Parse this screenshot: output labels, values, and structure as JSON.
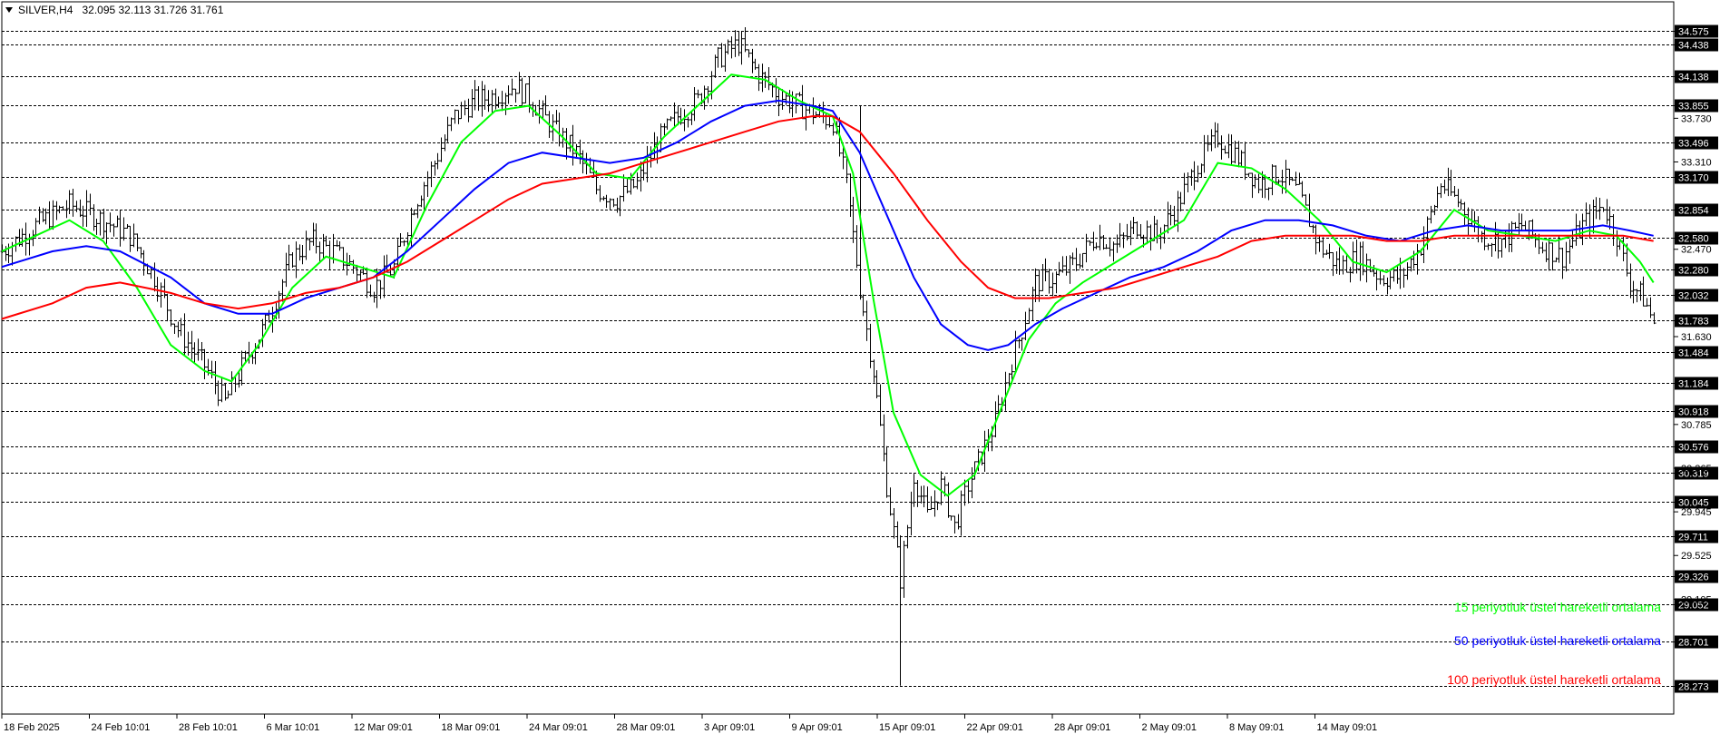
{
  "header": {
    "symbol_tf": "SILVER,H4",
    "ohlc": "32.095 32.113 31.726 31.761"
  },
  "legend": [
    {
      "label": "15 periyotluk üstel hareketli ortalama",
      "color": "#00ff00"
    },
    {
      "label": "50 periyotluk üstel hareketli ortalama",
      "color": "#0000ff"
    },
    {
      "label": "100 periyotluk üstel hareketli ortalama",
      "color": "#ff0000"
    }
  ],
  "chart_data": {
    "type": "line",
    "title": "SILVER,H4",
    "ylim": [
      28.0,
      34.85
    ],
    "grid": false,
    "legend_position": "bottom-right",
    "x_tick_labels": [
      "18 Feb 2025",
      "24 Feb 10:01",
      "28 Feb 10:01",
      "6 Mar 10:01",
      "12 Mar 09:01",
      "18 Mar 09:01",
      "24 Mar 09:01",
      "28 Mar 09:01",
      "3 Apr 09:01",
      "9 Apr 09:01",
      "15 Apr 09:01",
      "22 Apr 09:01",
      "28 Apr 09:01",
      "2 May 09:01",
      "8 May 09:01",
      "14 May 09:01"
    ],
    "y_tick_labels": [
      "33.730",
      "33.310",
      "32.470",
      "31.630",
      "30.785",
      "30.365",
      "29.945",
      "29.525",
      "29.105"
    ],
    "price_levels": [
      "34.575",
      "34.438",
      "34.138",
      "33.855",
      "33.496",
      "33.170",
      "32.854",
      "32.580",
      "32.280",
      "32.032",
      "31.783",
      "31.484",
      "31.184",
      "30.918",
      "30.576",
      "30.319",
      "30.045",
      "29.711",
      "29.326",
      "29.052",
      "28.701",
      "28.273"
    ],
    "close_series": {
      "name": "SILVER close",
      "points": [
        [
          0,
          32.45
        ],
        [
          10,
          32.7
        ],
        [
          20,
          32.9
        ],
        [
          30,
          32.75
        ],
        [
          38,
          32.6
        ],
        [
          45,
          32.2
        ],
        [
          52,
          31.7
        ],
        [
          60,
          31.35
        ],
        [
          66,
          31.0
        ],
        [
          72,
          31.4
        ],
        [
          78,
          31.75
        ],
        [
          86,
          32.4
        ],
        [
          92,
          32.55
        ],
        [
          98,
          32.45
        ],
        [
          104,
          32.3
        ],
        [
          110,
          32.1
        ],
        [
          116,
          32.3
        ],
        [
          122,
          32.9
        ],
        [
          128,
          33.3
        ],
        [
          134,
          33.75
        ],
        [
          140,
          33.9
        ],
        [
          146,
          33.95
        ],
        [
          152,
          34.05
        ],
        [
          158,
          33.85
        ],
        [
          164,
          33.6
        ],
        [
          170,
          33.4
        ],
        [
          176,
          33.05
        ],
        [
          182,
          32.95
        ],
        [
          188,
          33.1
        ],
        [
          194,
          33.5
        ],
        [
          200,
          33.75
        ],
        [
          206,
          33.9
        ],
        [
          212,
          34.3
        ],
        [
          218,
          34.45
        ],
        [
          224,
          34.15
        ],
        [
          230,
          33.95
        ],
        [
          236,
          33.85
        ],
        [
          242,
          33.75
        ],
        [
          246,
          33.7
        ],
        [
          250,
          33.1
        ],
        [
          254,
          32.1
        ],
        [
          258,
          31.3
        ],
        [
          262,
          30.2
        ],
        [
          266,
          29.3
        ],
        [
          270,
          30.3
        ],
        [
          274,
          29.9
        ],
        [
          278,
          30.2
        ],
        [
          282,
          29.8
        ],
        [
          286,
          30.2
        ],
        [
          290,
          30.5
        ],
        [
          294,
          30.8
        ],
        [
          298,
          31.3
        ],
        [
          302,
          31.7
        ],
        [
          306,
          32.15
        ],
        [
          312,
          32.2
        ],
        [
          318,
          32.35
        ],
        [
          324,
          32.6
        ],
        [
          330,
          32.5
        ],
        [
          336,
          32.7
        ],
        [
          342,
          32.6
        ],
        [
          348,
          32.9
        ],
        [
          354,
          33.3
        ],
        [
          360,
          33.55
        ],
        [
          366,
          33.35
        ],
        [
          372,
          33.1
        ],
        [
          378,
          33.2
        ],
        [
          384,
          33.0
        ],
        [
          390,
          32.5
        ],
        [
          396,
          32.3
        ],
        [
          402,
          32.4
        ],
        [
          408,
          32.2
        ],
        [
          414,
          32.2
        ],
        [
          420,
          32.5
        ],
        [
          426,
          33.1
        ],
        [
          432,
          32.9
        ],
        [
          438,
          32.6
        ],
        [
          444,
          32.55
        ],
        [
          450,
          32.7
        ],
        [
          456,
          32.5
        ],
        [
          462,
          32.4
        ],
        [
          468,
          32.7
        ],
        [
          474,
          32.9
        ],
        [
          478,
          32.6
        ],
        [
          482,
          32.15
        ],
        [
          486,
          32.0
        ],
        [
          489,
          31.76
        ]
      ]
    },
    "series": [
      {
        "name": "15 periyotluk üstel hareketli ortalama",
        "color": "#00ff00",
        "points": [
          [
            0,
            32.45
          ],
          [
            10,
            32.6
          ],
          [
            20,
            32.75
          ],
          [
            30,
            32.55
          ],
          [
            40,
            32.1
          ],
          [
            50,
            31.55
          ],
          [
            60,
            31.3
          ],
          [
            68,
            31.2
          ],
          [
            76,
            31.55
          ],
          [
            86,
            32.1
          ],
          [
            96,
            32.4
          ],
          [
            106,
            32.3
          ],
          [
            116,
            32.2
          ],
          [
            126,
            32.9
          ],
          [
            136,
            33.5
          ],
          [
            146,
            33.8
          ],
          [
            156,
            33.85
          ],
          [
            166,
            33.55
          ],
          [
            176,
            33.2
          ],
          [
            186,
            33.15
          ],
          [
            196,
            33.55
          ],
          [
            206,
            33.85
          ],
          [
            216,
            34.15
          ],
          [
            226,
            34.1
          ],
          [
            236,
            33.9
          ],
          [
            246,
            33.75
          ],
          [
            252,
            33.2
          ],
          [
            258,
            32.0
          ],
          [
            264,
            30.9
          ],
          [
            272,
            30.3
          ],
          [
            280,
            30.1
          ],
          [
            288,
            30.3
          ],
          [
            296,
            30.95
          ],
          [
            304,
            31.6
          ],
          [
            312,
            31.95
          ],
          [
            320,
            32.15
          ],
          [
            330,
            32.35
          ],
          [
            340,
            32.55
          ],
          [
            350,
            32.75
          ],
          [
            360,
            33.3
          ],
          [
            370,
            33.25
          ],
          [
            380,
            33.05
          ],
          [
            390,
            32.75
          ],
          [
            400,
            32.35
          ],
          [
            410,
            32.25
          ],
          [
            420,
            32.45
          ],
          [
            430,
            32.85
          ],
          [
            440,
            32.65
          ],
          [
            450,
            32.6
          ],
          [
            460,
            32.55
          ],
          [
            470,
            32.65
          ],
          [
            478,
            32.6
          ],
          [
            485,
            32.35
          ],
          [
            489,
            32.15
          ]
        ]
      },
      {
        "name": "50 periyotluk üstel hareketli ortalama",
        "color": "#0000ff",
        "points": [
          [
            0,
            32.3
          ],
          [
            15,
            32.45
          ],
          [
            25,
            32.5
          ],
          [
            35,
            32.45
          ],
          [
            50,
            32.2
          ],
          [
            60,
            31.95
          ],
          [
            70,
            31.85
          ],
          [
            80,
            31.85
          ],
          [
            90,
            32.0
          ],
          [
            100,
            32.1
          ],
          [
            110,
            32.2
          ],
          [
            120,
            32.45
          ],
          [
            130,
            32.75
          ],
          [
            140,
            33.05
          ],
          [
            150,
            33.3
          ],
          [
            160,
            33.4
          ],
          [
            170,
            33.35
          ],
          [
            180,
            33.3
          ],
          [
            190,
            33.35
          ],
          [
            200,
            33.5
          ],
          [
            210,
            33.7
          ],
          [
            220,
            33.85
          ],
          [
            230,
            33.9
          ],
          [
            240,
            33.85
          ],
          [
            246,
            33.8
          ],
          [
            254,
            33.4
          ],
          [
            262,
            32.8
          ],
          [
            270,
            32.2
          ],
          [
            278,
            31.75
          ],
          [
            286,
            31.55
          ],
          [
            292,
            31.5
          ],
          [
            298,
            31.55
          ],
          [
            306,
            31.75
          ],
          [
            314,
            31.9
          ],
          [
            324,
            32.05
          ],
          [
            334,
            32.2
          ],
          [
            344,
            32.3
          ],
          [
            354,
            32.45
          ],
          [
            364,
            32.65
          ],
          [
            374,
            32.75
          ],
          [
            384,
            32.75
          ],
          [
            394,
            32.7
          ],
          [
            404,
            32.6
          ],
          [
            414,
            32.55
          ],
          [
            424,
            32.65
          ],
          [
            434,
            32.7
          ],
          [
            444,
            32.65
          ],
          [
            454,
            32.65
          ],
          [
            464,
            32.65
          ],
          [
            474,
            32.7
          ],
          [
            482,
            32.65
          ],
          [
            489,
            32.6
          ]
        ]
      },
      {
        "name": "100 periyotluk üstel hareketli ortalama",
        "color": "#ff0000",
        "points": [
          [
            0,
            31.8
          ],
          [
            15,
            31.95
          ],
          [
            25,
            32.1
          ],
          [
            35,
            32.15
          ],
          [
            50,
            32.05
          ],
          [
            60,
            31.95
          ],
          [
            70,
            31.9
          ],
          [
            80,
            31.95
          ],
          [
            90,
            32.05
          ],
          [
            100,
            32.1
          ],
          [
            110,
            32.2
          ],
          [
            120,
            32.35
          ],
          [
            130,
            32.55
          ],
          [
            140,
            32.75
          ],
          [
            150,
            32.95
          ],
          [
            160,
            33.1
          ],
          [
            170,
            33.15
          ],
          [
            180,
            33.2
          ],
          [
            190,
            33.3
          ],
          [
            200,
            33.4
          ],
          [
            210,
            33.5
          ],
          [
            220,
            33.6
          ],
          [
            230,
            33.7
          ],
          [
            240,
            33.75
          ],
          [
            246,
            33.75
          ],
          [
            254,
            33.6
          ],
          [
            264,
            33.2
          ],
          [
            274,
            32.75
          ],
          [
            284,
            32.35
          ],
          [
            292,
            32.1
          ],
          [
            300,
            32.0
          ],
          [
            310,
            32.0
          ],
          [
            320,
            32.05
          ],
          [
            330,
            32.1
          ],
          [
            340,
            32.2
          ],
          [
            350,
            32.3
          ],
          [
            360,
            32.4
          ],
          [
            370,
            32.55
          ],
          [
            380,
            32.6
          ],
          [
            390,
            32.6
          ],
          [
            400,
            32.6
          ],
          [
            410,
            32.55
          ],
          [
            420,
            32.55
          ],
          [
            430,
            32.6
          ],
          [
            440,
            32.6
          ],
          [
            450,
            32.6
          ],
          [
            460,
            32.6
          ],
          [
            470,
            32.6
          ],
          [
            480,
            32.6
          ],
          [
            489,
            32.55
          ]
        ]
      }
    ]
  }
}
